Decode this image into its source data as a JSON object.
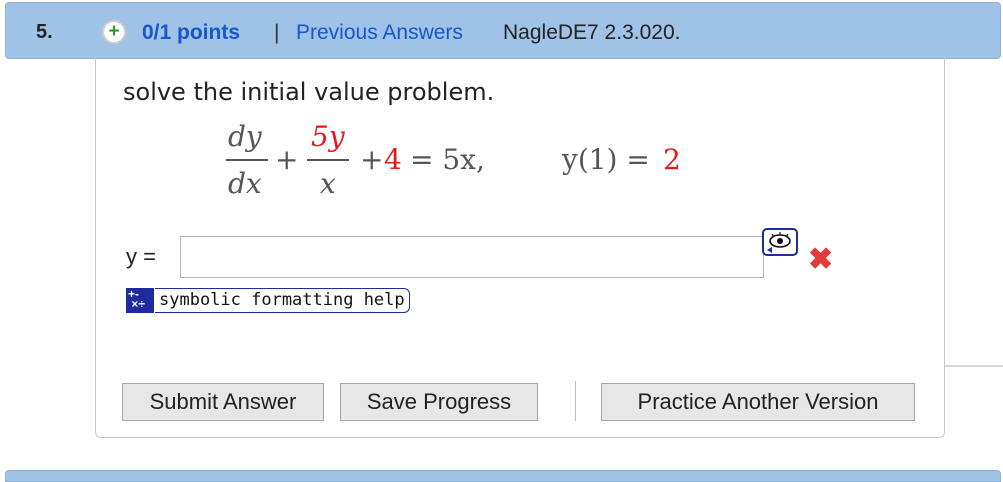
{
  "question": {
    "number": "5.",
    "points": "0/1 points",
    "separator": "|",
    "previous_answers_link": "Previous Answers",
    "code": "NagleDE7 2.3.020."
  },
  "prompt": "solve the initial value problem.",
  "equation": {
    "dy": "dy",
    "dx": "dx",
    "plus1": "+",
    "num2": "5y",
    "den2": "x",
    "plus2": "+",
    "const": "4",
    "rhs": "= 5x,",
    "ic_left": "y(1) =",
    "ic_value": "2"
  },
  "answer": {
    "label": "y =",
    "value": "",
    "preview_icon": "eye-icon",
    "status_icon": "x-mark-icon",
    "status_color": "#e23b3b"
  },
  "help": {
    "icon": "symbolic-help-icon",
    "label": "symbolic formatting help"
  },
  "buttons": {
    "submit": "Submit Answer",
    "save": "Save Progress",
    "practice": "Practice Another Version"
  },
  "colors": {
    "header_bg": "#9ec3e6",
    "link": "#1a55c9",
    "accent_red": "#e21c1c"
  }
}
